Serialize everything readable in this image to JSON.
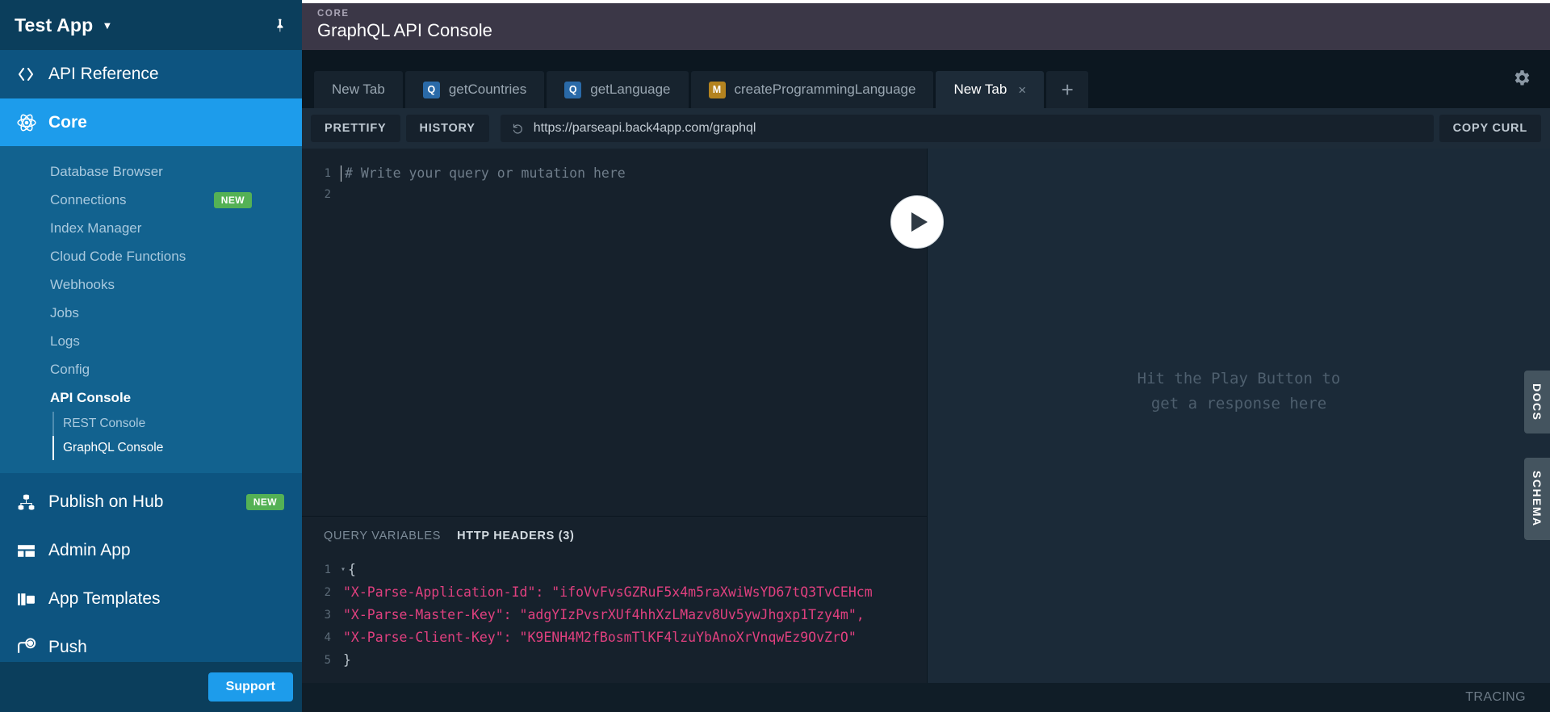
{
  "sidebar": {
    "app_name": "Test App",
    "caret_icon": "chevron-down-icon",
    "pin_icon": "pin-icon",
    "api_reference": {
      "label": "API Reference",
      "icon": "code-brackets-icon"
    },
    "core": {
      "label": "Core",
      "icon": "atom-icon"
    },
    "core_items": [
      {
        "label": "Database Browser",
        "badge": ""
      },
      {
        "label": "Connections",
        "badge": "NEW"
      },
      {
        "label": "Index Manager",
        "badge": ""
      },
      {
        "label": "Cloud Code Functions",
        "badge": ""
      },
      {
        "label": "Webhooks",
        "badge": ""
      },
      {
        "label": "Jobs",
        "badge": ""
      },
      {
        "label": "Logs",
        "badge": ""
      },
      {
        "label": "Config",
        "badge": ""
      },
      {
        "label": "API Console",
        "badge": ""
      }
    ],
    "api_console_children": [
      {
        "label": "REST Console"
      },
      {
        "label": "GraphQL Console"
      }
    ],
    "lower_items": [
      {
        "label": "Publish on Hub",
        "badge": "NEW",
        "icon": "hub-nodes-icon"
      },
      {
        "label": "Admin App",
        "badge": "",
        "icon": "dashboard-layout-icon"
      },
      {
        "label": "App Templates",
        "badge": "",
        "icon": "templates-icon"
      },
      {
        "label": "Push",
        "badge": "",
        "icon": "push-notification-icon"
      }
    ],
    "support_label": "Support"
  },
  "header": {
    "kicker": "CORE",
    "title": "GraphQL API Console",
    "gear_icon": "gear-icon"
  },
  "tabs": {
    "items": [
      {
        "label": "New Tab",
        "kind": "",
        "active": false,
        "closable": false
      },
      {
        "label": "getCountries",
        "kind": "Q",
        "active": false,
        "closable": false
      },
      {
        "label": "getLanguage",
        "kind": "Q",
        "active": false,
        "closable": false
      },
      {
        "label": "createProgrammingLanguage",
        "kind": "M",
        "active": false,
        "closable": false
      },
      {
        "label": "New Tab",
        "kind": "",
        "active": true,
        "closable": true
      }
    ],
    "add_label": "+",
    "close_glyph": "×"
  },
  "toolbar": {
    "prettify_label": "PRETTIFY",
    "history_label": "HISTORY",
    "copy_curl_label": "COPY CURL",
    "url_value": "https://parseapi.back4app.com/graphql",
    "url_icon": "history-undo-icon"
  },
  "editor": {
    "lines": [
      {
        "n": "1",
        "text": "# Write your query or mutation here"
      },
      {
        "n": "2",
        "text": ""
      }
    ]
  },
  "variables": {
    "tabs": [
      {
        "label": "QUERY VARIABLES",
        "active": false
      },
      {
        "label": "HTTP HEADERS (3)",
        "active": true
      }
    ],
    "lines": [
      {
        "n": "1",
        "fold": "▾",
        "content": "{"
      },
      {
        "n": "2",
        "fold": "",
        "content": "  \"X-Parse-Application-Id\": \"ifoVvFvsGZRuF5x4m5raXwiWsYD67tQ3TvCEHcm"
      },
      {
        "n": "3",
        "fold": "",
        "content": "  \"X-Parse-Master-Key\": \"adgYIzPvsrXUf4hhXzLMazv8Uv5ywJhgxp1Tzy4m\","
      },
      {
        "n": "4",
        "fold": "",
        "content": "  \"X-Parse-Client-Key\": \"K9ENH4M2fBosmTlKF4lzuYbAnoXrVnqwEz9OvZrO\""
      },
      {
        "n": "5",
        "fold": "",
        "content": "}"
      }
    ]
  },
  "result": {
    "placeholder_line1": "Hit the Play Button to",
    "placeholder_line2": "get a response here",
    "play_icon": "play-icon"
  },
  "side_tabs": [
    {
      "label": "DOCS"
    },
    {
      "label": "SCHEMA"
    }
  ],
  "status": {
    "tracing_label": "TRACING"
  },
  "colors": {
    "sidebar_bg": "#12628f",
    "sidebar_dark": "#0b3e5c",
    "accent": "#1d9ceb",
    "badge_green": "#54b155",
    "header_purple": "#3b3747",
    "editor_bg": "#16212c",
    "result_bg": "#1b2a38",
    "string_pink": "#e0407f",
    "query_chip": "#2a6aa8",
    "mutation_chip": "#b4831f"
  }
}
